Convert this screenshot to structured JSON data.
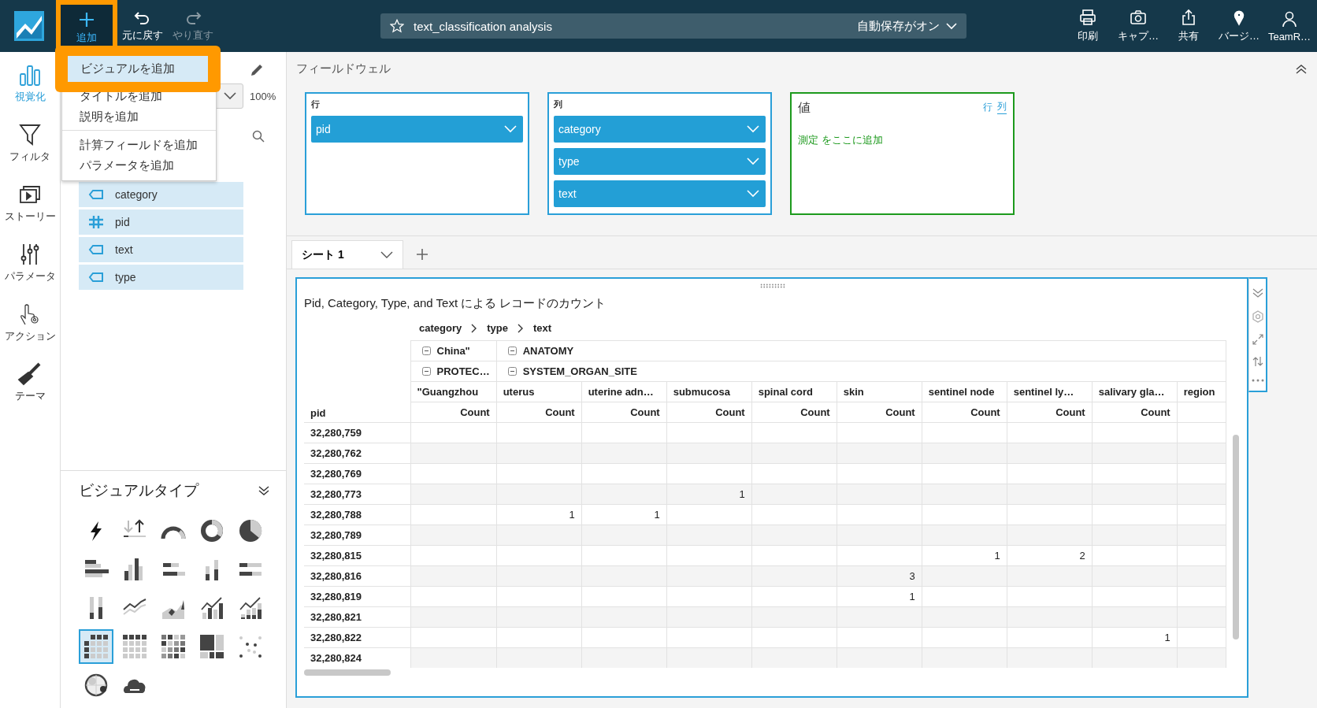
{
  "topbar": {
    "add": {
      "label": "追加",
      "highlighted": true
    },
    "history": [
      {
        "kind": "undo",
        "label": "元に戻す",
        "disabled": false
      },
      {
        "kind": "redo",
        "label": "やり直す",
        "disabled": true
      }
    ],
    "analysis_title": "text_classification analysis",
    "autosave": "自動保存がオン",
    "actions": [
      {
        "kind": "print",
        "label": "印刷"
      },
      {
        "kind": "camera",
        "label": "キャプ…"
      },
      {
        "kind": "share",
        "label": "共有"
      },
      {
        "kind": "pin",
        "label": "バージ…"
      },
      {
        "kind": "user",
        "label": "TeamR…"
      }
    ]
  },
  "rail": [
    {
      "kind": "visualize",
      "label": "視覚化",
      "selected": true
    },
    {
      "kind": "filter",
      "label": "フィルタ",
      "selected": false
    },
    {
      "kind": "story",
      "label": "ストーリー",
      "selected": false
    },
    {
      "kind": "parameter",
      "label": "パラメータ",
      "selected": false
    },
    {
      "kind": "action",
      "label": "アクション",
      "selected": false
    },
    {
      "kind": "theme",
      "label": "テーマ",
      "selected": false
    }
  ],
  "add_menu": [
    {
      "label": "ビジュアルを追加",
      "highlighted": true,
      "divider_before": false
    },
    {
      "label": "タイトルを追加",
      "highlighted": false,
      "divider_before": false
    },
    {
      "label": "説明を追加",
      "highlighted": false,
      "divider_before": false
    },
    {
      "label": "計算フィールドを追加",
      "highlighted": false,
      "divider_before": true
    },
    {
      "label": "パラメータを追加",
      "highlighted": false,
      "divider_before": false
    }
  ],
  "zoom": "100%",
  "fields": [
    {
      "kind": "dimension",
      "name": "category"
    },
    {
      "kind": "measure",
      "name": "pid"
    },
    {
      "kind": "dimension",
      "name": "text"
    },
    {
      "kind": "dimension",
      "name": "type"
    }
  ],
  "visual_types": {
    "title": "ビジュアルタイプ",
    "items": [
      {
        "kind": "kpi",
        "selected": false
      },
      {
        "kind": "change",
        "selected": false
      },
      {
        "kind": "gauge",
        "selected": false
      },
      {
        "kind": "donut",
        "selected": false
      },
      {
        "kind": "pie",
        "selected": false
      },
      {
        "kind": "hbar",
        "selected": false
      },
      {
        "kind": "vbar",
        "selected": false
      },
      {
        "kind": "hstack",
        "selected": false
      },
      {
        "kind": "vstack",
        "selected": false
      },
      {
        "kind": "hstack100",
        "selected": false
      },
      {
        "kind": "vstack100",
        "selected": false
      },
      {
        "kind": "line",
        "selected": false
      },
      {
        "kind": "area",
        "selected": false
      },
      {
        "kind": "combo",
        "selected": false
      },
      {
        "kind": "combostack",
        "selected": false
      },
      {
        "kind": "pivot",
        "selected": true
      },
      {
        "kind": "table",
        "selected": false
      },
      {
        "kind": "heatmap",
        "selected": false
      },
      {
        "kind": "treemap",
        "selected": false
      },
      {
        "kind": "scatter",
        "selected": false
      },
      {
        "kind": "map",
        "selected": false
      },
      {
        "kind": "wordcloud",
        "selected": false
      }
    ]
  },
  "field_wells": {
    "title": "フィールドウェル",
    "rows": {
      "label": "行",
      "fields": [
        "pid"
      ]
    },
    "columns": {
      "label": "列",
      "fields": [
        "category",
        "type",
        "text"
      ]
    },
    "values": {
      "label": "値",
      "toggles": [
        {
          "label": "行",
          "selected": false
        },
        {
          "label": "列",
          "selected": true
        }
      ],
      "hint": "測定 をここに追加"
    }
  },
  "sheet_tabs": [
    {
      "label": "シート 1"
    }
  ],
  "visual": {
    "title": "Pid, Category, Type, and Text による レコードのカウント",
    "hierarchy": [
      "category",
      "type",
      "text"
    ],
    "group_rows": [
      [
        {
          "label": "China\""
        },
        {
          "label": "ANATOMY"
        }
      ],
      [
        {
          "label": "PROTEC…"
        },
        {
          "label": "SYSTEM_ORGAN_SITE"
        }
      ]
    ],
    "row_header": "pid",
    "columns": [
      "\"Guangzhou",
      "uterus",
      "uterine adn…",
      "submucosa",
      "spinal cord",
      "skin",
      "sentinel node",
      "sentinel ly…",
      "salivary gla…",
      "region"
    ],
    "measure_labels": [
      "Count",
      "Count",
      "Count",
      "Count",
      "Count",
      "Count",
      "Count",
      "Count",
      "Count"
    ],
    "rows": [
      {
        "pid": "32,280,759",
        "cells": [
          null,
          null,
          null,
          null,
          null,
          null,
          null,
          null,
          null,
          null
        ]
      },
      {
        "pid": "32,280,762",
        "cells": [
          null,
          null,
          null,
          null,
          null,
          null,
          null,
          null,
          null,
          null
        ]
      },
      {
        "pid": "32,280,769",
        "cells": [
          null,
          null,
          null,
          null,
          null,
          null,
          null,
          null,
          null,
          null
        ]
      },
      {
        "pid": "32,280,773",
        "cells": [
          null,
          null,
          null,
          "1",
          null,
          null,
          null,
          null,
          null,
          null
        ]
      },
      {
        "pid": "32,280,788",
        "cells": [
          null,
          "1",
          "1",
          null,
          null,
          null,
          null,
          null,
          null,
          null
        ]
      },
      {
        "pid": "32,280,789",
        "cells": [
          null,
          null,
          null,
          null,
          null,
          null,
          null,
          null,
          null,
          null
        ]
      },
      {
        "pid": "32,280,815",
        "cells": [
          null,
          null,
          null,
          null,
          null,
          null,
          "1",
          "2",
          null,
          null
        ]
      },
      {
        "pid": "32,280,816",
        "cells": [
          null,
          null,
          null,
          null,
          null,
          "3",
          null,
          null,
          null,
          null
        ]
      },
      {
        "pid": "32,280,819",
        "cells": [
          null,
          null,
          null,
          null,
          null,
          "1",
          null,
          null,
          null,
          null
        ]
      },
      {
        "pid": "32,280,821",
        "cells": [
          null,
          null,
          null,
          null,
          null,
          null,
          null,
          null,
          null,
          null
        ]
      },
      {
        "pid": "32,280,822",
        "cells": [
          null,
          null,
          null,
          null,
          null,
          null,
          null,
          null,
          "1",
          null
        ]
      },
      {
        "pid": "32,280,824",
        "cells": [
          null,
          null,
          null,
          null,
          null,
          null,
          null,
          null,
          null,
          null
        ]
      }
    ]
  }
}
